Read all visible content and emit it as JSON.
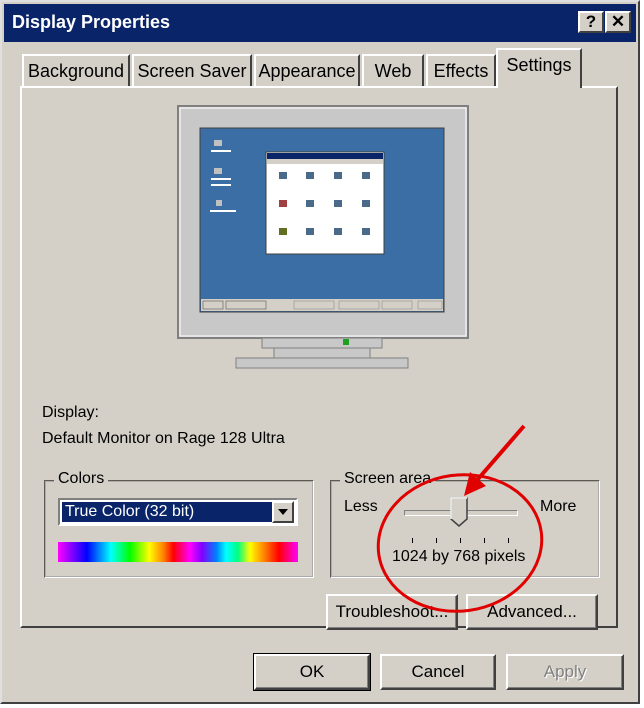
{
  "window": {
    "title": "Display Properties",
    "help_button": "?",
    "close_button": "✕"
  },
  "tabs": [
    {
      "label": "Background"
    },
    {
      "label": "Screen Saver"
    },
    {
      "label": "Appearance"
    },
    {
      "label": "Web"
    },
    {
      "label": "Effects"
    },
    {
      "label": "Settings",
      "active": true
    }
  ],
  "display": {
    "label": "Display:",
    "value": "Default Monitor on Rage 128 Ultra"
  },
  "colors": {
    "legend": "Colors",
    "selected": "True Color (32 bit)"
  },
  "screen_area": {
    "legend": "Screen area",
    "less_label": "Less",
    "more_label": "More",
    "resolution": "1024 by 768 pixels",
    "slider_level": 0.5
  },
  "buttons": {
    "troubleshoot": "Troubleshoot...",
    "advanced": "Advanced...",
    "ok": "OK",
    "cancel": "Cancel",
    "apply": "Apply"
  },
  "annotation_color": "#e00000",
  "accent_color": "#0a246a"
}
